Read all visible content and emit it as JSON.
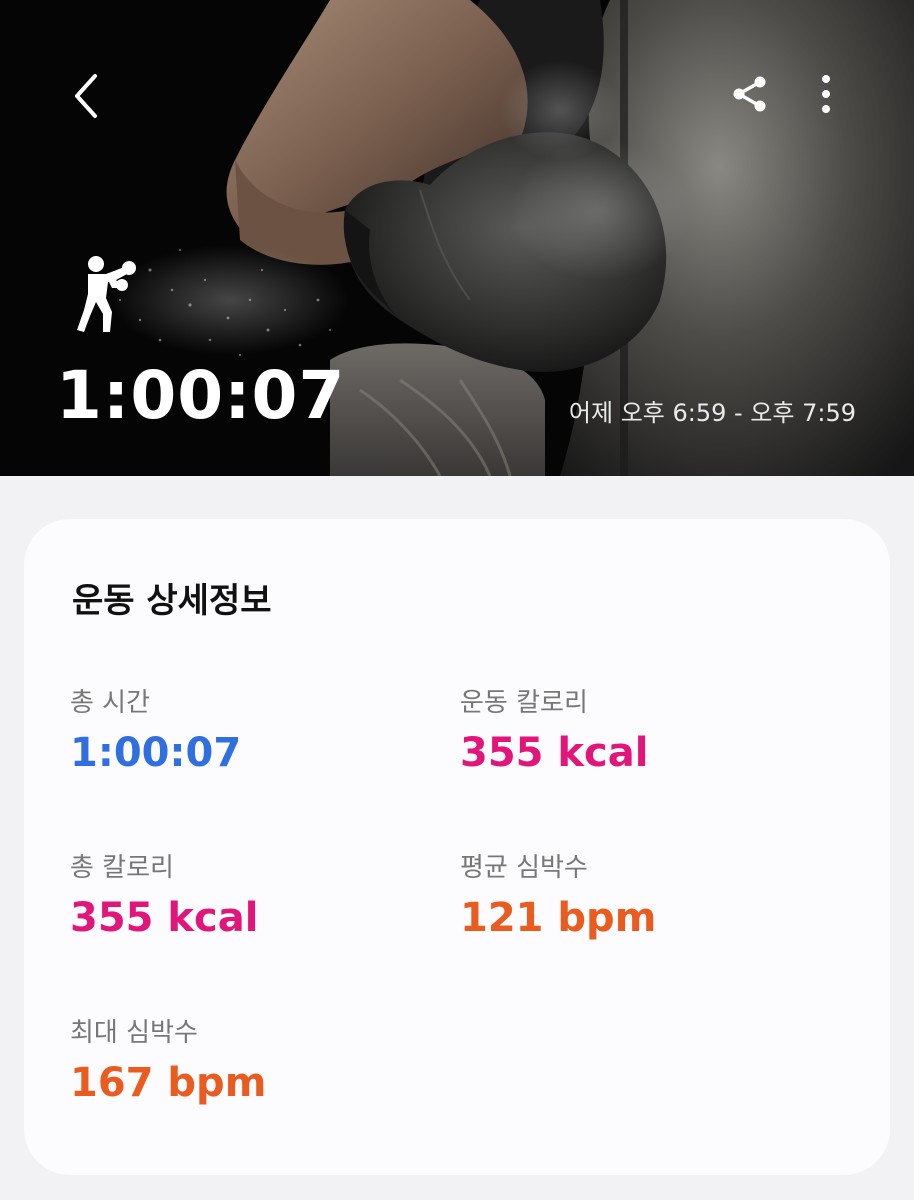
{
  "colors": {
    "duration": "#2f6fe0",
    "calories": "#e2157a",
    "heart_rate": "#ea5b20"
  },
  "header": {
    "back_icon": "chevron-left-icon",
    "share_icon": "share-icon",
    "more_icon": "more-vertical-icon",
    "sport_icon": "boxing-icon",
    "duration": "1:00:07",
    "time_range": "어제 오후 6:59 - 오후 7:59"
  },
  "details": {
    "title": "운동 상세정보",
    "stats": [
      {
        "label": "총 시간",
        "value": "1:00:07"
      },
      {
        "label": "운동 칼로리",
        "value": "355 kcal"
      },
      {
        "label": "총 칼로리",
        "value": "355 kcal"
      },
      {
        "label": "평균 심박수",
        "value": "121 bpm"
      },
      {
        "label": "최대 심박수",
        "value": "167 bpm"
      }
    ]
  }
}
